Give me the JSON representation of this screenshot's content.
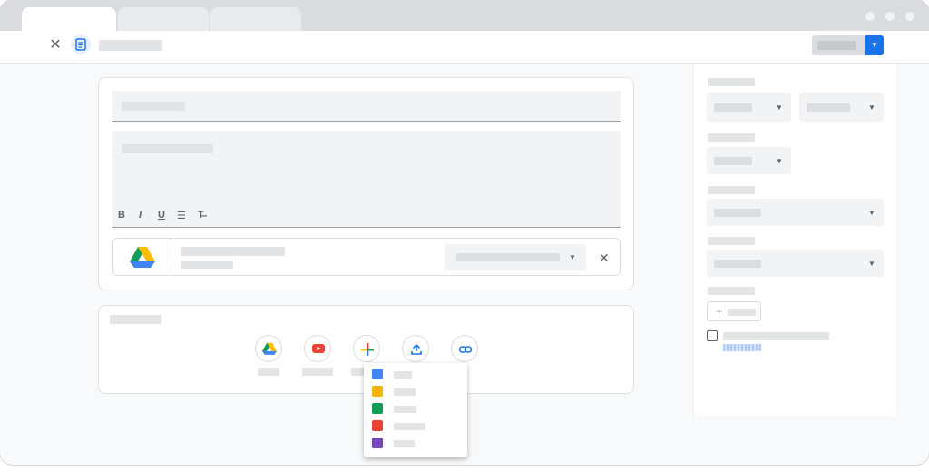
{
  "window": {
    "controls": [
      "minimize",
      "maximize",
      "close"
    ]
  },
  "appbar": {
    "close_icon": "close-icon",
    "app_icon": "assignment-icon",
    "close_glyph": "✕"
  },
  "editor": {
    "format_buttons": [
      {
        "name": "bold-button",
        "glyph": "B"
      },
      {
        "name": "italic-button",
        "glyph": "I"
      },
      {
        "name": "underline-button",
        "glyph": "U"
      },
      {
        "name": "bulleted-list-button",
        "glyph": "☰"
      },
      {
        "name": "clear-formatting-button",
        "glyph": "T̶"
      }
    ]
  },
  "attachment": {
    "icon": "google-drive-icon",
    "remove_glyph": "✕"
  },
  "add_bar": {
    "icons": [
      "google-drive-icon",
      "youtube-icon",
      "create-plus-icon",
      "upload-icon",
      "link-icon"
    ]
  },
  "create_menu": {
    "items": [
      {
        "icon": "docs-icon",
        "color": "#4285f4"
      },
      {
        "icon": "slides-icon",
        "color": "#f4b400"
      },
      {
        "icon": "sheets-icon",
        "color": "#0f9d58"
      },
      {
        "icon": "drawings-icon",
        "color": "#ea4335"
      },
      {
        "icon": "forms-icon",
        "color": "#7248b9"
      }
    ]
  },
  "sidebar": {
    "add_glyph": "+"
  },
  "colors": {
    "accent": "#1a73e8",
    "background": "#f8f9fa",
    "placeholder": "#e3e4e6"
  }
}
